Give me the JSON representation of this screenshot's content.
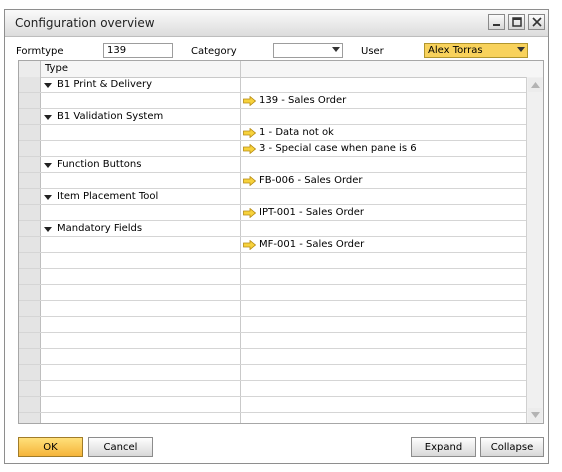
{
  "window": {
    "title": "Configuration overview"
  },
  "filters": {
    "formtype_label": "Formtype",
    "formtype_value": "139",
    "category_label": "Category",
    "category_value": "",
    "user_label": "User",
    "user_value": "Alex Torras"
  },
  "grid": {
    "header_type": "Type",
    "header_value": "",
    "rows": [
      {
        "kind": "group",
        "label": "B1 Print & Delivery"
      },
      {
        "kind": "item",
        "label": "139 - Sales Order"
      },
      {
        "kind": "group",
        "label": "B1 Validation System"
      },
      {
        "kind": "item",
        "label": "1 - Data not ok"
      },
      {
        "kind": "item",
        "label": "3 - Special case when pane is 6"
      },
      {
        "kind": "group",
        "label": "Function Buttons"
      },
      {
        "kind": "item",
        "label": "FB-006 - Sales Order"
      },
      {
        "kind": "group",
        "label": "Item Placement Tool"
      },
      {
        "kind": "item",
        "label": "IPT-001 - Sales Order"
      },
      {
        "kind": "group",
        "label": "Mandatory Fields"
      },
      {
        "kind": "item",
        "label": "MF-001 - Sales Order"
      }
    ],
    "empty_rows": 11
  },
  "buttons": {
    "ok": "OK",
    "cancel": "Cancel",
    "expand": "Expand",
    "collapse": "Collapse"
  },
  "colors": {
    "arrow_fill": "#f7d23c",
    "arrow_stroke": "#b58a12",
    "user_field_bg": "#f8d25c"
  },
  "icons": {
    "group_toggle": "triangle-down-icon",
    "item_link": "link-arrow-icon"
  }
}
